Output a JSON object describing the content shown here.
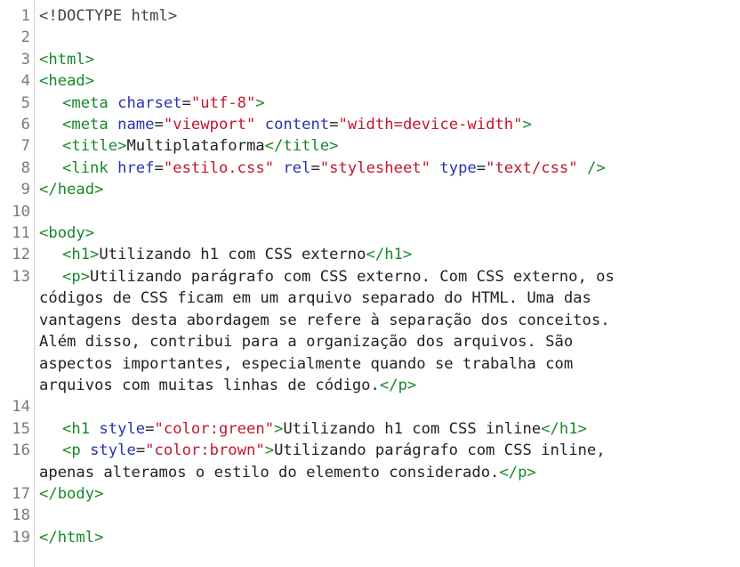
{
  "editor": {
    "lines": [
      {
        "number": "1",
        "doctype": "<!DOCTYPE html>"
      },
      {
        "number": "2"
      },
      {
        "number": "3",
        "tag": "<html>"
      },
      {
        "number": "4",
        "tag": "<head>"
      },
      {
        "number": "5",
        "open": "<meta",
        "a1": "charset",
        "eq1": "=",
        "v1": "\"utf-8\"",
        "close": ">"
      },
      {
        "number": "6",
        "open": "<meta",
        "a1": "name",
        "eq1": "=",
        "v1": "\"viewport\"",
        "a2": "content",
        "eq2": "=",
        "v2": "\"width=device-width\"",
        "close": ">"
      },
      {
        "number": "7",
        "open": "<title>",
        "text": "Multiplataforma",
        "close": "</title>"
      },
      {
        "number": "8",
        "open": "<link",
        "a1": "href",
        "eq1": "=",
        "v1": "\"estilo.css\"",
        "a2": "rel",
        "eq2": "=",
        "v2": "\"stylesheet\"",
        "a3": "type",
        "eq3": "=",
        "v3": "\"text/css\"",
        "close": " />"
      },
      {
        "number": "9",
        "tag": "</head>"
      },
      {
        "number": "10"
      },
      {
        "number": "11",
        "tag": "<body>"
      },
      {
        "number": "12",
        "open": "<h1>",
        "text": "Utilizando h1 com CSS externo",
        "close": "</h1>"
      },
      {
        "number": "13",
        "open": "<p>",
        "text": "Utilizando parágrafo com CSS externo. Com CSS externo, os"
      },
      {
        "cont": "códigos de CSS ficam em um arquivo separado do HTML. Uma das"
      },
      {
        "cont": "vantagens desta abordagem se refere à separação dos conceitos."
      },
      {
        "cont": "Além disso, contribui para a organização dos arquivos. São"
      },
      {
        "cont": "aspectos importantes, especialmente quando se trabalha com"
      },
      {
        "cont": "arquivos com muitas linhas de código.",
        "close": "</p>"
      },
      {
        "number": "14"
      },
      {
        "number": "15",
        "open": "<h1",
        "a1": "style",
        "eq1": "=",
        "v1": "\"color:green\"",
        "gt": ">",
        "text": "Utilizando h1 com CSS inline",
        "close": "</h1>"
      },
      {
        "number": "16",
        "open": "<p",
        "a1": "style",
        "eq1": "=",
        "v1": "\"color:brown\"",
        "gt": ">",
        "text": "Utilizando parágrafo com CSS inline,"
      },
      {
        "cont": "apenas alteramos o estilo do elemento considerado.",
        "close": "</p>"
      },
      {
        "number": "17",
        "tag": "</body>"
      },
      {
        "number": "18"
      },
      {
        "number": "19",
        "tag": "</html>"
      }
    ]
  }
}
